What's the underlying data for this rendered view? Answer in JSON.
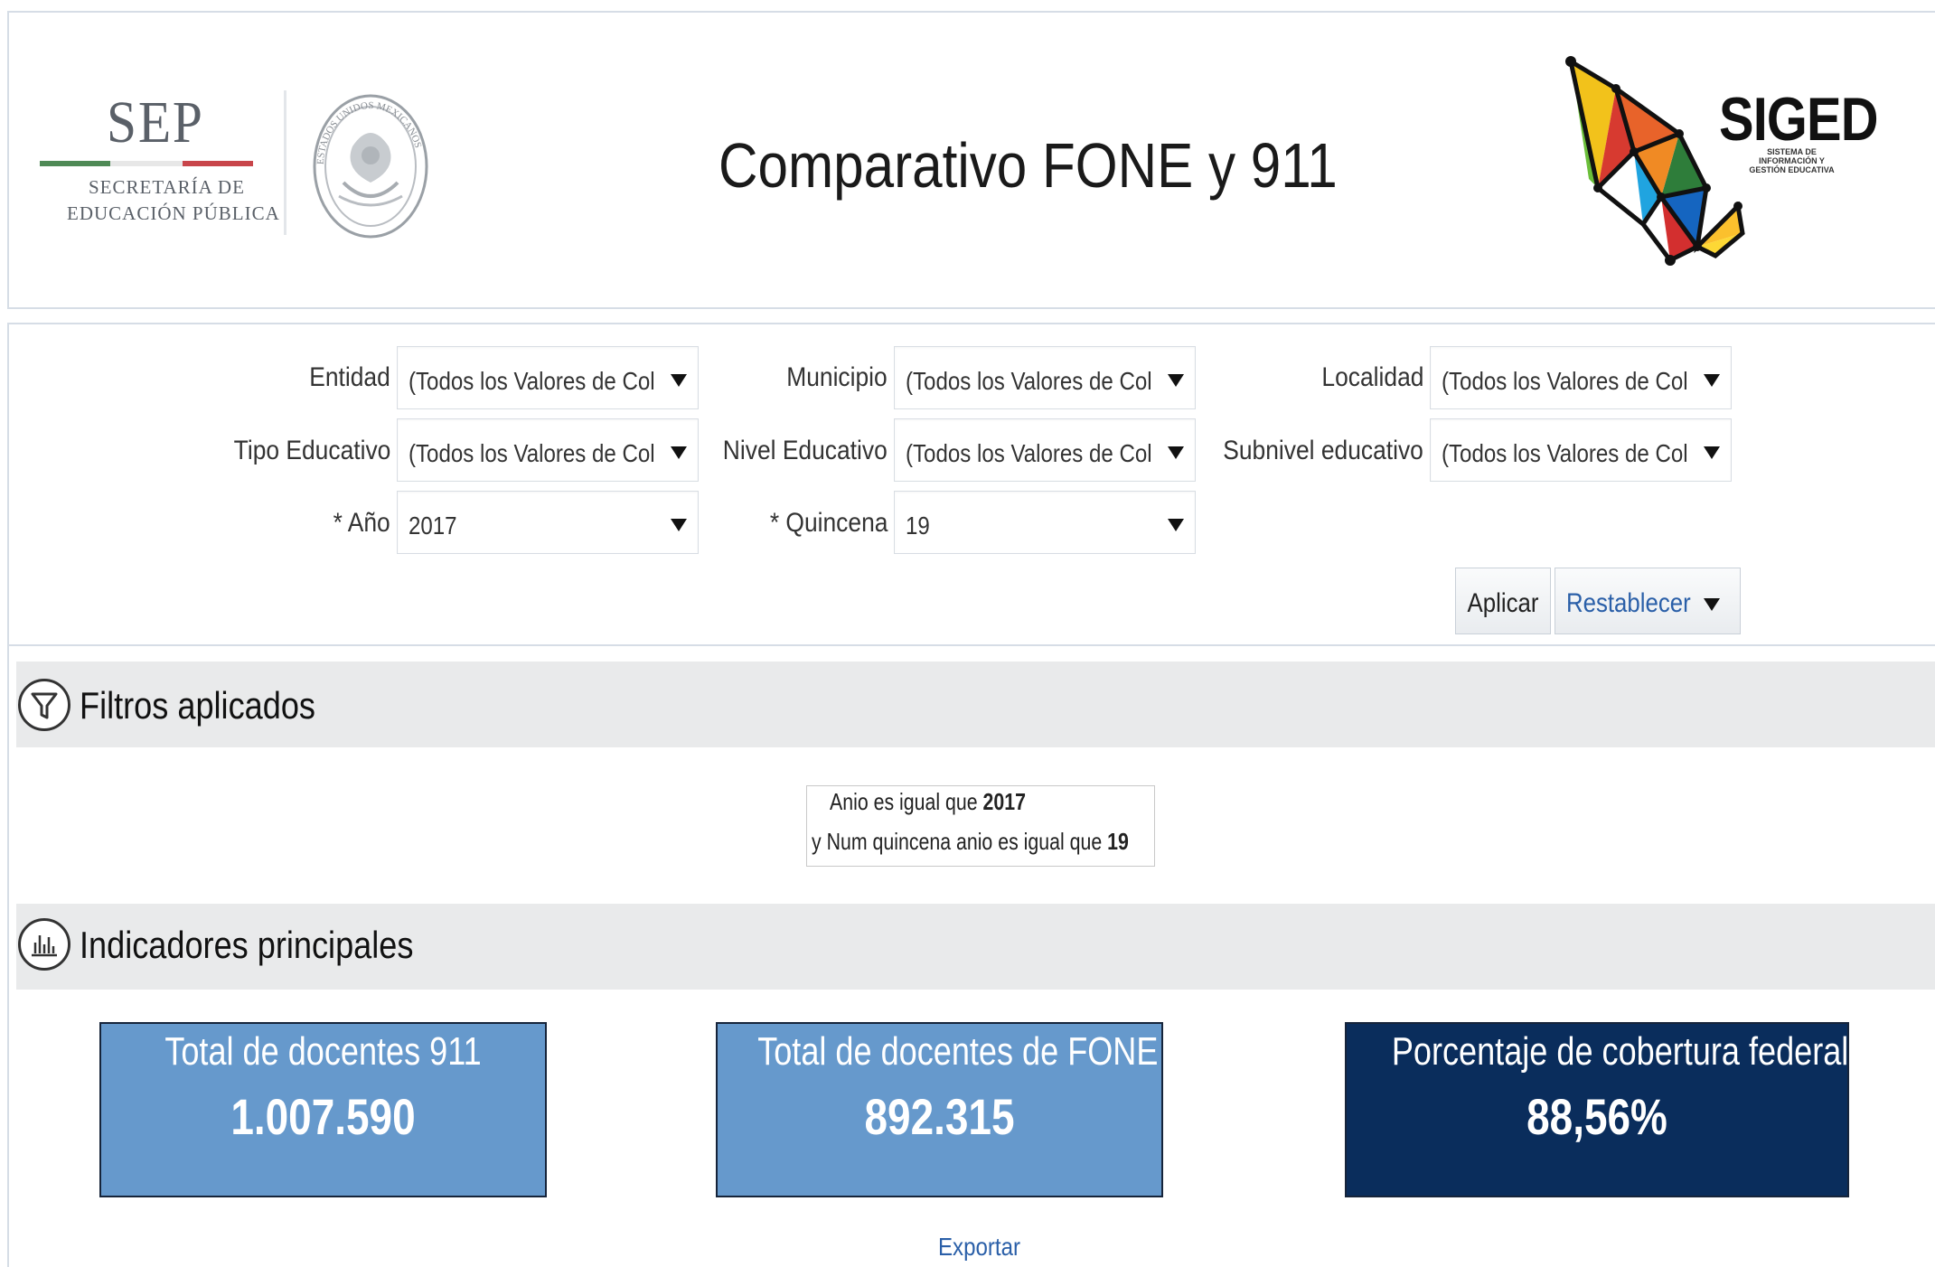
{
  "header": {
    "org_acronym": "SEP",
    "org_line1": "SECRETARÍA DE",
    "org_line2": "EDUCACIÓN PÚBLICA",
    "seal_text": "ESTADOS UNIDOS MEXICANOS",
    "title": "Comparativo FONE y 911",
    "brand": "SIGED",
    "brand_subtitle": "SISTEMA DE INFORMACIÓN Y GESTIÓN EDUCATIVA"
  },
  "filters": {
    "entidad": {
      "label": "Entidad",
      "value": "(Todos los Valores de Col"
    },
    "municipio": {
      "label": "Municipio",
      "value": "(Todos los Valores de Col"
    },
    "localidad": {
      "label": "Localidad",
      "value": "(Todos los Valores de Col"
    },
    "tipo_educativo": {
      "label": "Tipo Educativo",
      "value": "(Todos los Valores de Col"
    },
    "nivel_educativo": {
      "label": "Nivel Educativo",
      "value": "(Todos los Valores de Col"
    },
    "subnivel_educativo": {
      "label": "Subnivel educativo",
      "value": "(Todos los Valores de Col"
    },
    "anio": {
      "label": "* Año",
      "value": "2017"
    },
    "quincena": {
      "label": "* Quincena",
      "value": "19"
    },
    "apply_label": "Aplicar",
    "reset_label": "Restablecer"
  },
  "applied_filters": {
    "title": "Filtros aplicados",
    "line1_text": "Anio es igual que ",
    "line1_value": "2017",
    "line2_text": "y  Num quincena anio es igual que ",
    "line2_value": "19"
  },
  "indicators": {
    "title": "Indicadores principales",
    "tiles": [
      {
        "title": "Total de docentes 911",
        "value": "1.007.590",
        "color": "#6699cc"
      },
      {
        "title": "Total de docentes de FONE",
        "value": "892.315",
        "color": "#6699cc"
      },
      {
        "title": "Porcentaje de cobertura federal",
        "value": "88,56%",
        "color": "#0a2d5c"
      }
    ],
    "export_label": "Exportar"
  }
}
